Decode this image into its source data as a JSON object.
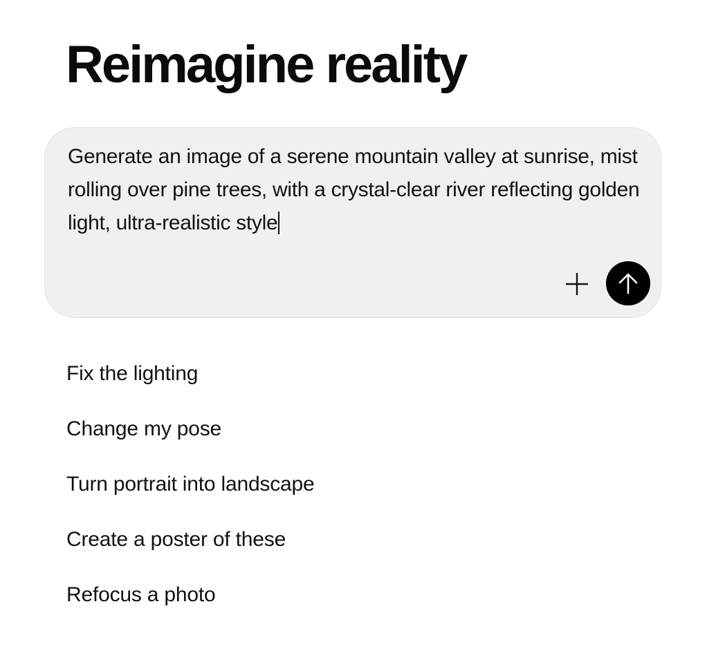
{
  "heading": "Reimagine reality",
  "composer": {
    "prompt_text": "Generate an image of a serene mountain valley at sunrise, mist rolling over pine trees, with a crystal-clear river reflecting golden light, ultra-realistic style",
    "add_icon": "plus-icon",
    "send_icon": "arrow-up-icon"
  },
  "suggestions": [
    "Fix the lighting",
    "Change my pose",
    "Turn portrait into landscape",
    "Create a poster of these",
    "Refocus a photo"
  ]
}
